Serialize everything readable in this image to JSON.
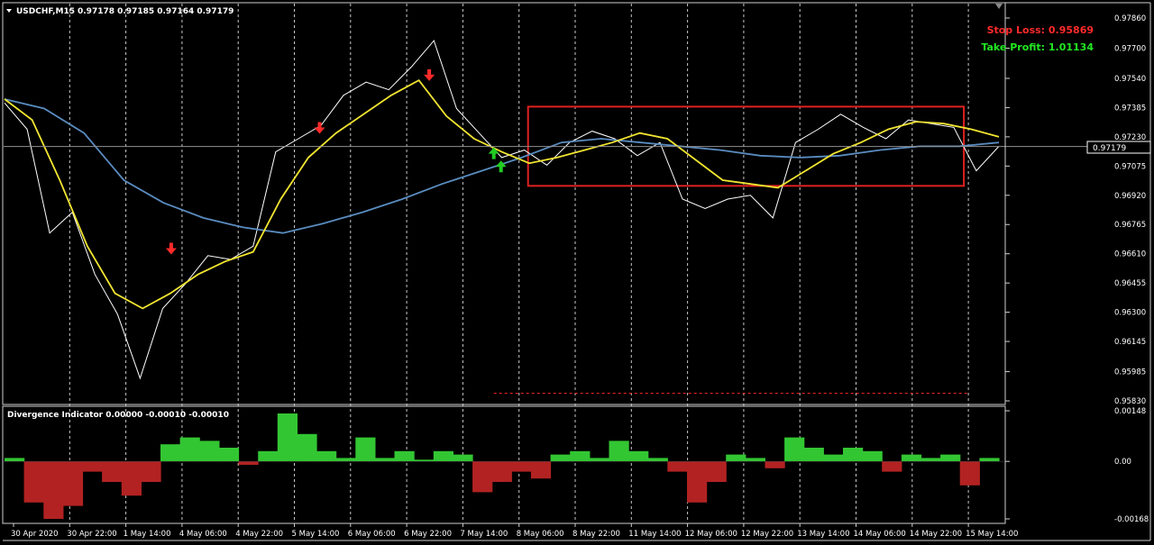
{
  "chart_header": {
    "symbol_timeframe": "USDCHF,M15",
    "ohlc": "0.97178 0.97185 0.97164 0.97179"
  },
  "stop_loss_label": "Stop Loss: 0.95869",
  "take_profit_label": "Take Profit: 1.01134",
  "current_price_tag": "0.97179",
  "indicator_header": "Divergence Indicator 0.00000 -0.00010 -0.00010",
  "colors": {
    "background": "#000000",
    "price": "#ffffff",
    "ma_fast": "#f2e531",
    "ma_slow": "#5a8cc0",
    "range_box": "#e02020",
    "hist_up": "#33c633",
    "hist_down": "#b22222",
    "stop_loss": "#ff2a2a",
    "take_profit": "#22e822",
    "arrow_sell": "#ff2a2a",
    "arrow_buy": "#22cc22",
    "grid": "#c8c8c8"
  },
  "chart_data": [
    {
      "type": "line",
      "title": "USDCHF,M15",
      "x": [
        "30 Apr 2020",
        "30 Apr 22:00",
        "1 May 14:00",
        "4 May 06:00",
        "4 May 22:00",
        "5 May 14:00",
        "6 May 06:00",
        "6 May 22:00",
        "7 May 14:00",
        "8 May 06:00",
        "8 May 22:00",
        "11 May 14:00",
        "12 May 06:00",
        "12 May 22:00",
        "13 May 14:00",
        "14 May 06:00",
        "14 May 22:00",
        "15 May 14:00"
      ],
      "y_ticks": [
        "0.97860",
        "0.97700",
        "0.97540",
        "0.97385",
        "0.97230",
        "0.97075",
        "0.96920",
        "0.96765",
        "0.96610",
        "0.96455",
        "0.96300",
        "0.96145",
        "0.95985",
        "0.95830"
      ],
      "ylim": [
        0.9583,
        0.9786
      ],
      "current_price": 0.97179,
      "grid": true,
      "range_box": {
        "x_start": "8 May 06:00",
        "x_end": "15 May 14:00",
        "y_low": 0.9697,
        "y_high": 0.9739
      },
      "dashed_level": {
        "x_start": "8 May 06:00",
        "x_end": "15 May 14:00",
        "y": 0.9587
      },
      "series": [
        {
          "role": "price",
          "y": [
            0.9741,
            0.9727,
            0.9672,
            0.9683,
            0.965,
            0.9629,
            0.9595,
            0.9632,
            0.9645,
            0.966,
            0.9658,
            0.9665,
            0.9715,
            0.9722,
            0.9729,
            0.9745,
            0.9752,
            0.9748,
            0.976,
            0.9774,
            0.9738,
            0.9725,
            0.9712,
            0.9716,
            0.9708,
            0.972,
            0.9726,
            0.9722,
            0.9713,
            0.972,
            0.969,
            0.9685,
            0.969,
            0.9692,
            0.968,
            0.972,
            0.9727,
            0.9735,
            0.9728,
            0.9722,
            0.9732,
            0.973,
            0.9728,
            0.9705,
            0.9718
          ]
        },
        {
          "role": "ma_fast",
          "y": [
            0.9743,
            0.9732,
            0.97,
            0.9665,
            0.964,
            0.9632,
            0.964,
            0.965,
            0.9657,
            0.9662,
            0.969,
            0.9712,
            0.9725,
            0.9735,
            0.9745,
            0.9753,
            0.9734,
            0.9722,
            0.9715,
            0.9709,
            0.9712,
            0.9716,
            0.972,
            0.9725,
            0.9722,
            0.9711,
            0.97,
            0.9698,
            0.9696,
            0.9705,
            0.9714,
            0.972,
            0.9727,
            0.9731,
            0.973,
            0.9727,
            0.9723
          ]
        },
        {
          "role": "ma_slow",
          "y": [
            0.9743,
            0.9738,
            0.9725,
            0.97,
            0.9688,
            0.968,
            0.9675,
            0.9672,
            0.9677,
            0.9683,
            0.969,
            0.9698,
            0.9705,
            0.9712,
            0.972,
            0.9722,
            0.972,
            0.9718,
            0.9716,
            0.9713,
            0.9712,
            0.9713,
            0.9716,
            0.9718,
            0.9718,
            0.972
          ]
        }
      ],
      "sell_arrows": [
        {
          "x": "4 May 06:00",
          "y": 0.9663
        },
        {
          "x": "5 May 14:00",
          "y": 0.9727
        },
        {
          "x": "6 May 22:00",
          "y": 0.9755
        }
      ],
      "buy_arrows": [
        {
          "x": "8 May 06:00",
          "y": 0.9715
        },
        {
          "x": "8 May 06:00",
          "y": 0.9708
        }
      ]
    },
    {
      "type": "bar",
      "title": "Divergence Indicator",
      "y_ticks": [
        "0.00148",
        "0.00",
        "-0.00168"
      ],
      "ylim": [
        -0.00168,
        0.00148
      ],
      "series": [
        {
          "role": "histogram",
          "y": [
            0.0001,
            -0.0012,
            -0.00168,
            -0.0013,
            -0.0003,
            -0.0006,
            -0.001,
            -0.0006,
            0.0005,
            0.0007,
            0.0006,
            0.0004,
            -0.0001,
            0.0003,
            0.0014,
            0.0008,
            0.0003,
            0.0001,
            0.0007,
            0.0001,
            0.0003,
            5e-05,
            0.0003,
            0.0002,
            -0.0009,
            -0.0006,
            -0.0003,
            -0.0005,
            0.0002,
            0.0003,
            0.0001,
            0.0006,
            0.0003,
            0.0001,
            -0.0003,
            -0.0012,
            -0.0006,
            0.0002,
            0.0001,
            -0.0002,
            0.0007,
            0.0004,
            0.0002,
            0.0004,
            0.0003,
            -0.0003,
            0.0002,
            0.0001,
            0.0002,
            -0.0007,
            0.0001
          ]
        }
      ]
    }
  ]
}
